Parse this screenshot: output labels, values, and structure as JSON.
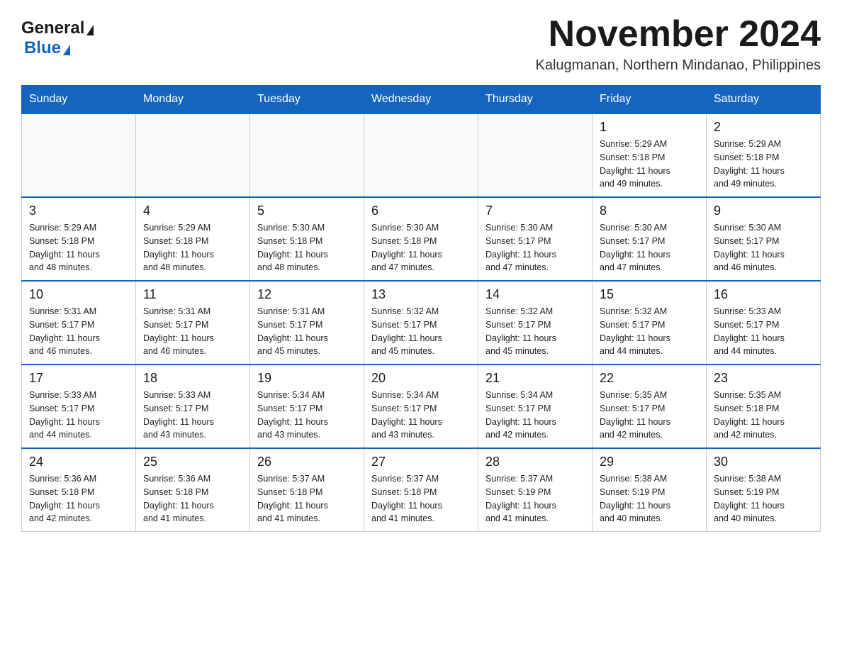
{
  "logo": {
    "general_text": "General",
    "blue_text": "Blue"
  },
  "header": {
    "month_year": "November 2024",
    "location": "Kalugmanan, Northern Mindanao, Philippines"
  },
  "days_of_week": [
    "Sunday",
    "Monday",
    "Tuesday",
    "Wednesday",
    "Thursday",
    "Friday",
    "Saturday"
  ],
  "weeks": [
    {
      "days": [
        {
          "number": "",
          "info": ""
        },
        {
          "number": "",
          "info": ""
        },
        {
          "number": "",
          "info": ""
        },
        {
          "number": "",
          "info": ""
        },
        {
          "number": "",
          "info": ""
        },
        {
          "number": "1",
          "info": "Sunrise: 5:29 AM\nSunset: 5:18 PM\nDaylight: 11 hours\nand 49 minutes."
        },
        {
          "number": "2",
          "info": "Sunrise: 5:29 AM\nSunset: 5:18 PM\nDaylight: 11 hours\nand 49 minutes."
        }
      ]
    },
    {
      "days": [
        {
          "number": "3",
          "info": "Sunrise: 5:29 AM\nSunset: 5:18 PM\nDaylight: 11 hours\nand 48 minutes."
        },
        {
          "number": "4",
          "info": "Sunrise: 5:29 AM\nSunset: 5:18 PM\nDaylight: 11 hours\nand 48 minutes."
        },
        {
          "number": "5",
          "info": "Sunrise: 5:30 AM\nSunset: 5:18 PM\nDaylight: 11 hours\nand 48 minutes."
        },
        {
          "number": "6",
          "info": "Sunrise: 5:30 AM\nSunset: 5:18 PM\nDaylight: 11 hours\nand 47 minutes."
        },
        {
          "number": "7",
          "info": "Sunrise: 5:30 AM\nSunset: 5:17 PM\nDaylight: 11 hours\nand 47 minutes."
        },
        {
          "number": "8",
          "info": "Sunrise: 5:30 AM\nSunset: 5:17 PM\nDaylight: 11 hours\nand 47 minutes."
        },
        {
          "number": "9",
          "info": "Sunrise: 5:30 AM\nSunset: 5:17 PM\nDaylight: 11 hours\nand 46 minutes."
        }
      ]
    },
    {
      "days": [
        {
          "number": "10",
          "info": "Sunrise: 5:31 AM\nSunset: 5:17 PM\nDaylight: 11 hours\nand 46 minutes."
        },
        {
          "number": "11",
          "info": "Sunrise: 5:31 AM\nSunset: 5:17 PM\nDaylight: 11 hours\nand 46 minutes."
        },
        {
          "number": "12",
          "info": "Sunrise: 5:31 AM\nSunset: 5:17 PM\nDaylight: 11 hours\nand 45 minutes."
        },
        {
          "number": "13",
          "info": "Sunrise: 5:32 AM\nSunset: 5:17 PM\nDaylight: 11 hours\nand 45 minutes."
        },
        {
          "number": "14",
          "info": "Sunrise: 5:32 AM\nSunset: 5:17 PM\nDaylight: 11 hours\nand 45 minutes."
        },
        {
          "number": "15",
          "info": "Sunrise: 5:32 AM\nSunset: 5:17 PM\nDaylight: 11 hours\nand 44 minutes."
        },
        {
          "number": "16",
          "info": "Sunrise: 5:33 AM\nSunset: 5:17 PM\nDaylight: 11 hours\nand 44 minutes."
        }
      ]
    },
    {
      "days": [
        {
          "number": "17",
          "info": "Sunrise: 5:33 AM\nSunset: 5:17 PM\nDaylight: 11 hours\nand 44 minutes."
        },
        {
          "number": "18",
          "info": "Sunrise: 5:33 AM\nSunset: 5:17 PM\nDaylight: 11 hours\nand 43 minutes."
        },
        {
          "number": "19",
          "info": "Sunrise: 5:34 AM\nSunset: 5:17 PM\nDaylight: 11 hours\nand 43 minutes."
        },
        {
          "number": "20",
          "info": "Sunrise: 5:34 AM\nSunset: 5:17 PM\nDaylight: 11 hours\nand 43 minutes."
        },
        {
          "number": "21",
          "info": "Sunrise: 5:34 AM\nSunset: 5:17 PM\nDaylight: 11 hours\nand 42 minutes."
        },
        {
          "number": "22",
          "info": "Sunrise: 5:35 AM\nSunset: 5:17 PM\nDaylight: 11 hours\nand 42 minutes."
        },
        {
          "number": "23",
          "info": "Sunrise: 5:35 AM\nSunset: 5:18 PM\nDaylight: 11 hours\nand 42 minutes."
        }
      ]
    },
    {
      "days": [
        {
          "number": "24",
          "info": "Sunrise: 5:36 AM\nSunset: 5:18 PM\nDaylight: 11 hours\nand 42 minutes."
        },
        {
          "number": "25",
          "info": "Sunrise: 5:36 AM\nSunset: 5:18 PM\nDaylight: 11 hours\nand 41 minutes."
        },
        {
          "number": "26",
          "info": "Sunrise: 5:37 AM\nSunset: 5:18 PM\nDaylight: 11 hours\nand 41 minutes."
        },
        {
          "number": "27",
          "info": "Sunrise: 5:37 AM\nSunset: 5:18 PM\nDaylight: 11 hours\nand 41 minutes."
        },
        {
          "number": "28",
          "info": "Sunrise: 5:37 AM\nSunset: 5:19 PM\nDaylight: 11 hours\nand 41 minutes."
        },
        {
          "number": "29",
          "info": "Sunrise: 5:38 AM\nSunset: 5:19 PM\nDaylight: 11 hours\nand 40 minutes."
        },
        {
          "number": "30",
          "info": "Sunrise: 5:38 AM\nSunset: 5:19 PM\nDaylight: 11 hours\nand 40 minutes."
        }
      ]
    }
  ]
}
